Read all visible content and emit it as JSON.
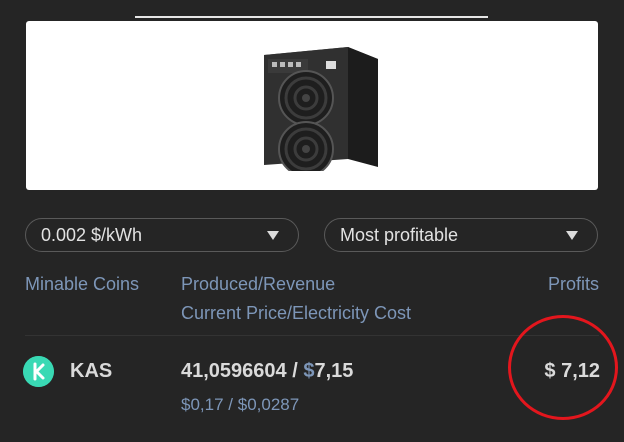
{
  "selects": {
    "electricity": {
      "value": "0.002 $/kWh"
    },
    "sort": {
      "value": "Most profitable"
    }
  },
  "table": {
    "headers": {
      "coins": "Minable Coins",
      "produced": "Produced/Revenue",
      "price_cost": "Current Price/Electricity Cost",
      "profits": "Profits"
    },
    "rows": [
      {
        "coin": "KAS",
        "produced": "41,0596604",
        "separator": "/",
        "revenue_symbol": "$",
        "revenue": "7,15",
        "price": "$0,17",
        "slash": "/",
        "electricity_cost": "$0,0287",
        "profit": "$ 7,12"
      }
    ]
  },
  "colors": {
    "background": "#252525",
    "label_blue": "#7d96b8",
    "kas_icon": "#39d9b4",
    "annotation_red": "#e3161d"
  },
  "icons": {
    "coin": "kaspa-logo-icon",
    "dropdown": "caret-down-icon",
    "product": "asic-miner-image"
  }
}
